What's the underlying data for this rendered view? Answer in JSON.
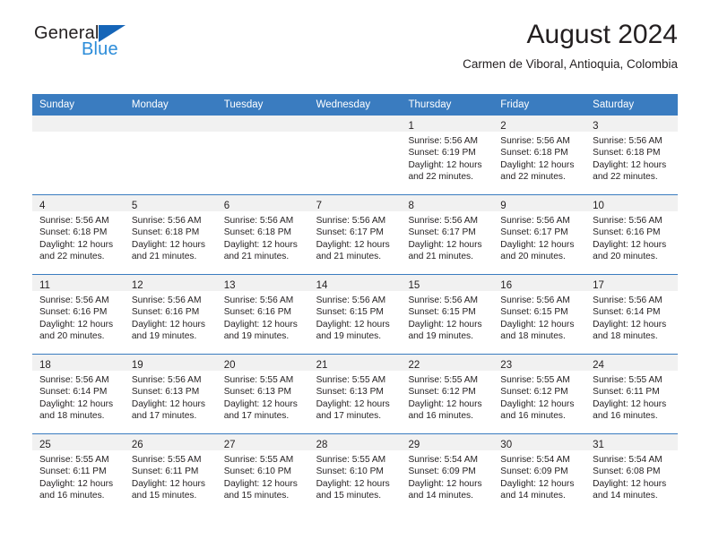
{
  "brand": {
    "name_part1": "General",
    "name_part2": "Blue",
    "triangle_icon": "triangle-icon",
    "colors": {
      "dark": "#231f20",
      "blue": "#2b8cd9",
      "triangle": "#1565b8"
    }
  },
  "header": {
    "title": "August 2024",
    "subtitle": "Carmen de Viboral, Antioquia, Colombia"
  },
  "calendar": {
    "header_bg": "#3a7cc0",
    "day_band_bg": "#f1f1f1",
    "weekdays": [
      "Sunday",
      "Monday",
      "Tuesday",
      "Wednesday",
      "Thursday",
      "Friday",
      "Saturday"
    ],
    "weeks": [
      [
        {
          "day": "",
          "lines": []
        },
        {
          "day": "",
          "lines": []
        },
        {
          "day": "",
          "lines": []
        },
        {
          "day": "",
          "lines": []
        },
        {
          "day": "1",
          "lines": [
            "Sunrise: 5:56 AM",
            "Sunset: 6:19 PM",
            "Daylight: 12 hours",
            "and 22 minutes."
          ]
        },
        {
          "day": "2",
          "lines": [
            "Sunrise: 5:56 AM",
            "Sunset: 6:18 PM",
            "Daylight: 12 hours",
            "and 22 minutes."
          ]
        },
        {
          "day": "3",
          "lines": [
            "Sunrise: 5:56 AM",
            "Sunset: 6:18 PM",
            "Daylight: 12 hours",
            "and 22 minutes."
          ]
        }
      ],
      [
        {
          "day": "4",
          "lines": [
            "Sunrise: 5:56 AM",
            "Sunset: 6:18 PM",
            "Daylight: 12 hours",
            "and 22 minutes."
          ]
        },
        {
          "day": "5",
          "lines": [
            "Sunrise: 5:56 AM",
            "Sunset: 6:18 PM",
            "Daylight: 12 hours",
            "and 21 minutes."
          ]
        },
        {
          "day": "6",
          "lines": [
            "Sunrise: 5:56 AM",
            "Sunset: 6:18 PM",
            "Daylight: 12 hours",
            "and 21 minutes."
          ]
        },
        {
          "day": "7",
          "lines": [
            "Sunrise: 5:56 AM",
            "Sunset: 6:17 PM",
            "Daylight: 12 hours",
            "and 21 minutes."
          ]
        },
        {
          "day": "8",
          "lines": [
            "Sunrise: 5:56 AM",
            "Sunset: 6:17 PM",
            "Daylight: 12 hours",
            "and 21 minutes."
          ]
        },
        {
          "day": "9",
          "lines": [
            "Sunrise: 5:56 AM",
            "Sunset: 6:17 PM",
            "Daylight: 12 hours",
            "and 20 minutes."
          ]
        },
        {
          "day": "10",
          "lines": [
            "Sunrise: 5:56 AM",
            "Sunset: 6:16 PM",
            "Daylight: 12 hours",
            "and 20 minutes."
          ]
        }
      ],
      [
        {
          "day": "11",
          "lines": [
            "Sunrise: 5:56 AM",
            "Sunset: 6:16 PM",
            "Daylight: 12 hours",
            "and 20 minutes."
          ]
        },
        {
          "day": "12",
          "lines": [
            "Sunrise: 5:56 AM",
            "Sunset: 6:16 PM",
            "Daylight: 12 hours",
            "and 19 minutes."
          ]
        },
        {
          "day": "13",
          "lines": [
            "Sunrise: 5:56 AM",
            "Sunset: 6:16 PM",
            "Daylight: 12 hours",
            "and 19 minutes."
          ]
        },
        {
          "day": "14",
          "lines": [
            "Sunrise: 5:56 AM",
            "Sunset: 6:15 PM",
            "Daylight: 12 hours",
            "and 19 minutes."
          ]
        },
        {
          "day": "15",
          "lines": [
            "Sunrise: 5:56 AM",
            "Sunset: 6:15 PM",
            "Daylight: 12 hours",
            "and 19 minutes."
          ]
        },
        {
          "day": "16",
          "lines": [
            "Sunrise: 5:56 AM",
            "Sunset: 6:15 PM",
            "Daylight: 12 hours",
            "and 18 minutes."
          ]
        },
        {
          "day": "17",
          "lines": [
            "Sunrise: 5:56 AM",
            "Sunset: 6:14 PM",
            "Daylight: 12 hours",
            "and 18 minutes."
          ]
        }
      ],
      [
        {
          "day": "18",
          "lines": [
            "Sunrise: 5:56 AM",
            "Sunset: 6:14 PM",
            "Daylight: 12 hours",
            "and 18 minutes."
          ]
        },
        {
          "day": "19",
          "lines": [
            "Sunrise: 5:56 AM",
            "Sunset: 6:13 PM",
            "Daylight: 12 hours",
            "and 17 minutes."
          ]
        },
        {
          "day": "20",
          "lines": [
            "Sunrise: 5:55 AM",
            "Sunset: 6:13 PM",
            "Daylight: 12 hours",
            "and 17 minutes."
          ]
        },
        {
          "day": "21",
          "lines": [
            "Sunrise: 5:55 AM",
            "Sunset: 6:13 PM",
            "Daylight: 12 hours",
            "and 17 minutes."
          ]
        },
        {
          "day": "22",
          "lines": [
            "Sunrise: 5:55 AM",
            "Sunset: 6:12 PM",
            "Daylight: 12 hours",
            "and 16 minutes."
          ]
        },
        {
          "day": "23",
          "lines": [
            "Sunrise: 5:55 AM",
            "Sunset: 6:12 PM",
            "Daylight: 12 hours",
            "and 16 minutes."
          ]
        },
        {
          "day": "24",
          "lines": [
            "Sunrise: 5:55 AM",
            "Sunset: 6:11 PM",
            "Daylight: 12 hours",
            "and 16 minutes."
          ]
        }
      ],
      [
        {
          "day": "25",
          "lines": [
            "Sunrise: 5:55 AM",
            "Sunset: 6:11 PM",
            "Daylight: 12 hours",
            "and 16 minutes."
          ]
        },
        {
          "day": "26",
          "lines": [
            "Sunrise: 5:55 AM",
            "Sunset: 6:11 PM",
            "Daylight: 12 hours",
            "and 15 minutes."
          ]
        },
        {
          "day": "27",
          "lines": [
            "Sunrise: 5:55 AM",
            "Sunset: 6:10 PM",
            "Daylight: 12 hours",
            "and 15 minutes."
          ]
        },
        {
          "day": "28",
          "lines": [
            "Sunrise: 5:55 AM",
            "Sunset: 6:10 PM",
            "Daylight: 12 hours",
            "and 15 minutes."
          ]
        },
        {
          "day": "29",
          "lines": [
            "Sunrise: 5:54 AM",
            "Sunset: 6:09 PM",
            "Daylight: 12 hours",
            "and 14 minutes."
          ]
        },
        {
          "day": "30",
          "lines": [
            "Sunrise: 5:54 AM",
            "Sunset: 6:09 PM",
            "Daylight: 12 hours",
            "and 14 minutes."
          ]
        },
        {
          "day": "31",
          "lines": [
            "Sunrise: 5:54 AM",
            "Sunset: 6:08 PM",
            "Daylight: 12 hours",
            "and 14 minutes."
          ]
        }
      ]
    ]
  }
}
